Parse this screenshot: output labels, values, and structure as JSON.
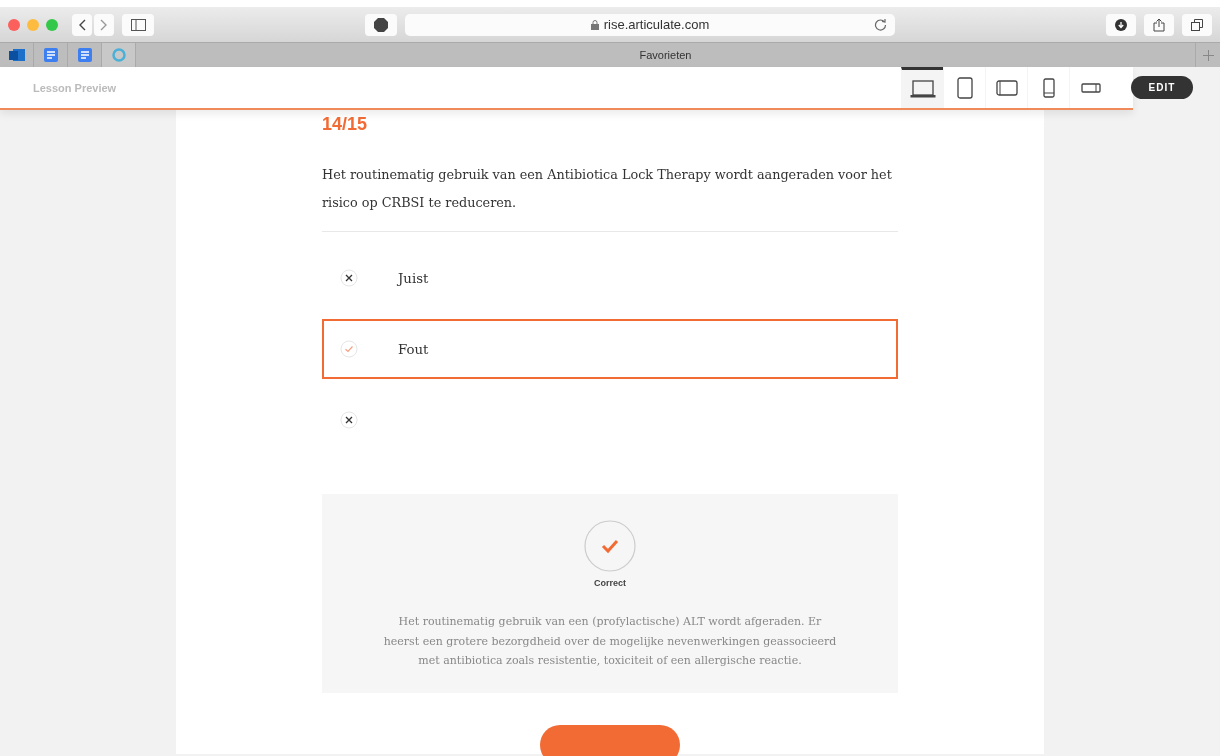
{
  "browser": {
    "url": "rise.articulate.com",
    "favorites_title": "Favorieten"
  },
  "header": {
    "title": "Lesson Preview",
    "devices": [
      {
        "kind": "laptop",
        "selected": true
      },
      {
        "kind": "tablet",
        "selected": false
      },
      {
        "kind": "tablet-landscape",
        "selected": false
      },
      {
        "kind": "phone",
        "selected": false
      },
      {
        "kind": "phone-landscape",
        "selected": false
      }
    ],
    "edit_button": "EDIT"
  },
  "question": {
    "counter": "14/15",
    "text": "Het routinematig gebruik van een Antibiotica Lock Therapy wordt aangeraden voor het risico op CRBSI te reduceren.",
    "options": [
      {
        "label": "Juist",
        "kind": "cross",
        "selected": false
      },
      {
        "label": "Fout",
        "kind": "check",
        "selected": true
      },
      {
        "kind": "cross",
        "selected": false
      }
    ]
  },
  "feedback": {
    "kind": "check",
    "title": "Correct",
    "text": "Het routinematig gebruik van een (profylactische) ALT wordt afgeraden. Er heerst een grotere bezorgdheid over de mogelijke nevenwerkingen geassocieerd met antibiotica zoals resistentie, toxiciteit of een allergische reactie."
  }
}
